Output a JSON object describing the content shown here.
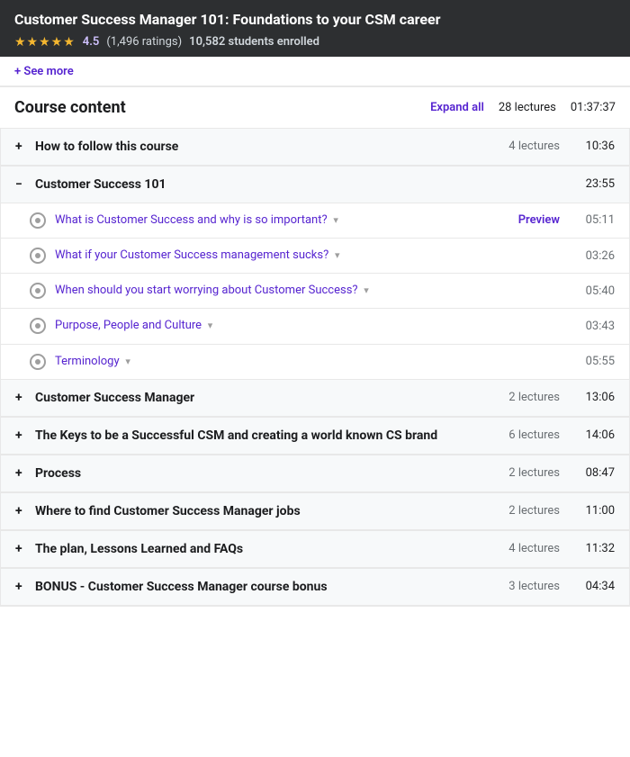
{
  "header": {
    "title": "Customer Success Manager 101: Foundations to your CSM career",
    "stars": "★★★★★",
    "rating": "4.5",
    "ratings_count": "(1,496 ratings)",
    "enrolled": "10,582 students enrolled"
  },
  "see_more": {
    "label": "+ See more"
  },
  "course_content": {
    "title": "Course content",
    "expand_all_label": "Expand all",
    "lecture_count": "28 lectures",
    "total_duration": "01:37:37"
  },
  "sections": [
    {
      "id": "section-1",
      "toggle": "+",
      "name": "How to follow this course",
      "lectures": "4 lectures",
      "duration": "10:36",
      "expanded": false,
      "items": []
    },
    {
      "id": "section-2",
      "toggle": "−",
      "name": "Customer Success 101",
      "lectures": "",
      "duration": "23:55",
      "expanded": true,
      "items": [
        {
          "title": "What is Customer Success and why is so important?",
          "has_dropdown": true,
          "preview": "Preview",
          "duration": "05:11"
        },
        {
          "title": "What if your Customer Success management sucks?",
          "has_dropdown": true,
          "preview": "",
          "duration": "03:26"
        },
        {
          "title": "When should you start worrying about Customer Success?",
          "has_dropdown": true,
          "preview": "",
          "duration": "05:40"
        },
        {
          "title": "Purpose, People and Culture",
          "has_dropdown": true,
          "preview": "",
          "duration": "03:43"
        },
        {
          "title": "Terminology",
          "has_dropdown": true,
          "preview": "",
          "duration": "05:55"
        }
      ]
    },
    {
      "id": "section-3",
      "toggle": "+",
      "name": "Customer Success Manager",
      "lectures": "2 lectures",
      "duration": "13:06",
      "expanded": false,
      "items": []
    },
    {
      "id": "section-4",
      "toggle": "+",
      "name": "The Keys to be a Successful CSM and creating a world known CS brand",
      "lectures": "6 lectures",
      "duration": "14:06",
      "expanded": false,
      "items": []
    },
    {
      "id": "section-5",
      "toggle": "+",
      "name": "Process",
      "lectures": "2 lectures",
      "duration": "08:47",
      "expanded": false,
      "items": []
    },
    {
      "id": "section-6",
      "toggle": "+",
      "name": "Where to find Customer Success Manager jobs",
      "lectures": "2 lectures",
      "duration": "11:00",
      "expanded": false,
      "items": []
    },
    {
      "id": "section-7",
      "toggle": "+",
      "name": "The plan, Lessons Learned and FAQs",
      "lectures": "4 lectures",
      "duration": "11:32",
      "expanded": false,
      "items": []
    },
    {
      "id": "section-8",
      "toggle": "+",
      "name": "BONUS - Customer Success Manager course bonus",
      "lectures": "3 lectures",
      "duration": "04:34",
      "expanded": false,
      "items": []
    }
  ]
}
